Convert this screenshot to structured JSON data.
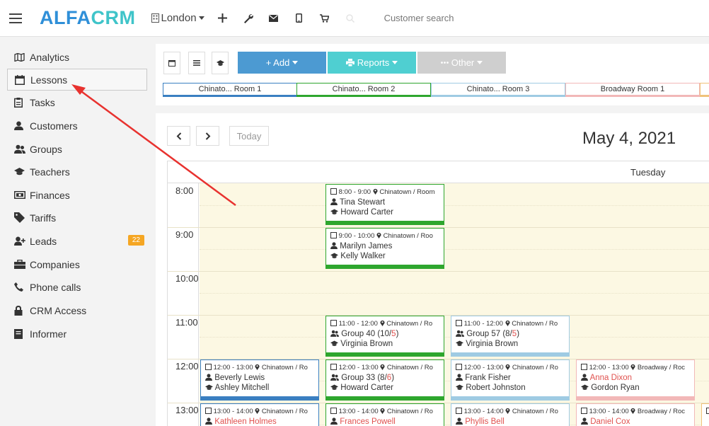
{
  "header": {
    "logo_part1": "ALFA",
    "logo_part2": "CRM",
    "branch": "London",
    "search_placeholder": "Customer search"
  },
  "sidebar": {
    "items": [
      {
        "label": "Analytics",
        "icon": "analytics-icon"
      },
      {
        "label": "Lessons",
        "icon": "calendar-icon",
        "active": true
      },
      {
        "label": "Tasks",
        "icon": "tasks-icon"
      },
      {
        "label": "Customers",
        "icon": "user-icon"
      },
      {
        "label": "Groups",
        "icon": "users-icon"
      },
      {
        "label": "Teachers",
        "icon": "graduation-cap-icon"
      },
      {
        "label": "Finances",
        "icon": "money-icon"
      },
      {
        "label": "Tariffs",
        "icon": "tag-icon"
      },
      {
        "label": "Leads",
        "icon": "user-plus-icon",
        "badge": "22"
      },
      {
        "label": "Companies",
        "icon": "briefcase-icon"
      },
      {
        "label": "Phone calls",
        "icon": "phone-icon"
      },
      {
        "label": "CRM Access",
        "icon": "lock-icon"
      },
      {
        "label": "Informer",
        "icon": "book-icon"
      }
    ]
  },
  "toolbar": {
    "add_label": "+ Add",
    "reports_label": "Reports",
    "other_label": "Other"
  },
  "rooms": [
    {
      "label": "Chinato... Room 1",
      "color": "#3a7fc1"
    },
    {
      "label": "Chinato... Room 2",
      "color": "#2ea62e"
    },
    {
      "label": "Chinato... Room 3",
      "color": "#9fcbe3"
    },
    {
      "label": "Broadway Room 1",
      "color": "#f2b8b8"
    }
  ],
  "calendar": {
    "today_label": "Today",
    "date_title": "May 4, 2021",
    "day_name": "Tuesday",
    "hours": [
      "8:00",
      "9:00",
      "10:00",
      "11:00",
      "12:00",
      "13:00"
    ]
  },
  "lessons": [
    {
      "time": "8:00 - 9:00",
      "location": "Chinatown / Room",
      "who": "Tina Stewart",
      "who_icon": "user-icon",
      "teacher": "Howard Carter",
      "color": "#2ea62e"
    },
    {
      "time": "9:00 - 10:00",
      "location": "Chinatown / Roo",
      "who": "Marilyn James",
      "who_icon": "user-icon",
      "teacher": "Kelly Walker",
      "color": "#2ea62e"
    },
    {
      "time": "11:00 - 12:00",
      "location": "Chinatown / Ro",
      "who": "Group 40 (10/",
      "who_num": "5",
      "who_tail": ")",
      "who_icon": "users-icon",
      "teacher": "Virginia Brown",
      "color": "#2ea62e"
    },
    {
      "time": "11:00 - 12:00",
      "location": "Chinatown / Ro",
      "who": "Group 57 (8/",
      "who_num": "5",
      "who_tail": ")",
      "who_icon": "users-icon",
      "teacher": "Virginia Brown",
      "color": "#9fcbe3"
    },
    {
      "time": "12:00 - 13:00",
      "location": "Chinatown / Ro",
      "who": "Beverly Lewis",
      "who_icon": "user-icon",
      "teacher": "Ashley Mitchell",
      "color": "#3a7fc1"
    },
    {
      "time": "12:00 - 13:00",
      "location": "Chinatown / Ro",
      "who": "Group 33 (8/",
      "who_num": "6",
      "who_tail": ")",
      "who_icon": "users-icon",
      "teacher": "Howard Carter",
      "color": "#2ea62e"
    },
    {
      "time": "12:00 - 13:00",
      "location": "Chinatown / Ro",
      "who": "Frank Fisher",
      "who_icon": "user-icon",
      "teacher": "Robert Johnston",
      "color": "#9fcbe3"
    },
    {
      "time": "12:00 - 13:00",
      "location": "Broadway / Roc",
      "who": "Anna Dixon",
      "who_icon": "user-icon",
      "who_red": true,
      "teacher": "Gordon Ryan",
      "color": "#f2b8b8"
    },
    {
      "time": "13:00 - 14:00",
      "location": "Chinatown / Ro",
      "who": "Kathleen Holmes",
      "who_icon": "user-icon",
      "who_red": true,
      "teacher": "",
      "color": "#3a7fc1"
    },
    {
      "time": "13:00 - 14:00",
      "location": "Chinatown / Ro",
      "who": "Frances Powell",
      "who_icon": "user-icon",
      "who_red": true,
      "teacher": "",
      "color": "#2ea62e"
    },
    {
      "time": "13:00 - 14:00",
      "location": "Chinatown / Ro",
      "who": "Phyllis Bell",
      "who_icon": "user-icon",
      "who_red": true,
      "teacher": "",
      "color": "#9fcbe3"
    },
    {
      "time": "13:00 - 14:00",
      "location": "Broadway / Roc",
      "who": "Daniel Cox",
      "who_icon": "user-icon",
      "who_red": true,
      "teacher": "",
      "color": "#f2b8b8"
    }
  ]
}
